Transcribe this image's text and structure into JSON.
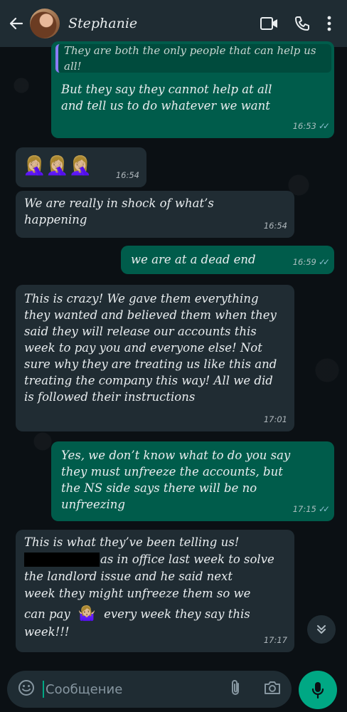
{
  "header": {
    "contact_name": "Stephanie",
    "icons": [
      "back-arrow-icon",
      "video-call-icon",
      "voice-call-icon",
      "more-options-icon"
    ]
  },
  "messages": [
    {
      "id": "m1",
      "direction": "outgoing",
      "quoted_text": "They are both the only people that can help us all!",
      "text": "But they say they cannot help at all and tell us to do whatever we want",
      "time": "16:53",
      "status": "read"
    },
    {
      "id": "m2",
      "direction": "incoming",
      "text": "🤦🏼‍♀️🤦🏼‍♀️🤦🏼‍♀️",
      "time": "16:54"
    },
    {
      "id": "m3",
      "direction": "incoming",
      "text": "We are really in shock of what’s happening",
      "time": "16:54"
    },
    {
      "id": "m4",
      "direction": "outgoing",
      "text": "we are at a dead end",
      "time": "16:59",
      "status": "read"
    },
    {
      "id": "m5",
      "direction": "incoming",
      "text": "This is crazy! We gave them everything they wanted and believed them when they said they will release our accounts this week to pay you and everyone else! Not sure why they are treating us like this and treating the company this way! All we did is followed their instructions",
      "time": "17:01"
    },
    {
      "id": "m6",
      "direction": "outgoing",
      "text": "Yes, we don’t know what to do you say they must unfreeze the accounts, but the NS side says there will be no unfreezing",
      "time": "17:15",
      "status": "read"
    },
    {
      "id": "m7",
      "direction": "incoming",
      "line1": "This is what they’ve been telling us!",
      "line2_after_redaction": "as in office last week to solve",
      "line3": "the landlord issue and he said next",
      "line4": "week they might unfreeze them so we",
      "line5_before_emoji": "can pay",
      "emoji": "🤷🏼‍♀️",
      "line5_after_emoji": "every week they say this",
      "line6": "week!!!",
      "time": "17:17"
    }
  ],
  "composer": {
    "placeholder": "Сообщение",
    "icons": [
      "emoji-icon",
      "attach-icon",
      "camera-icon",
      "mic-icon"
    ]
  },
  "colors": {
    "background": "#0b1014",
    "header": "#1f2c33",
    "incoming_bubble": "#202c33",
    "outgoing_bubble": "#005c4b",
    "accent": "#00a884",
    "read_ticks": "#53bdeb"
  }
}
